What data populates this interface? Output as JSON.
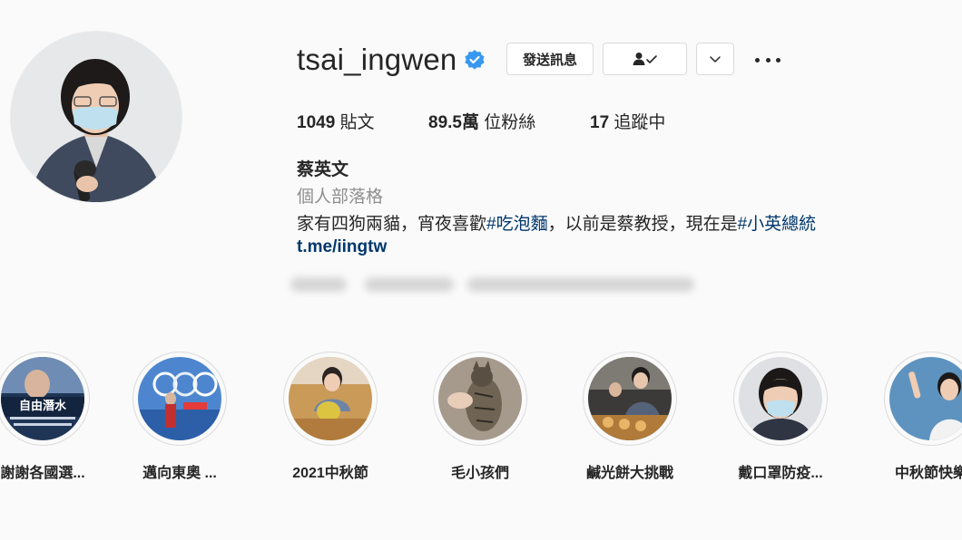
{
  "profile": {
    "username": "tsai_ingwen",
    "verified": true,
    "avatar_icon": "profile-photo",
    "buttons": {
      "message_label": "發送訊息",
      "following_icon": "user-check-icon",
      "dropdown_icon": "chevron-down-icon",
      "more_icon": "more-horizontal-icon"
    },
    "stats": {
      "posts_count": "1049",
      "posts_label": "貼文",
      "followers_count": "89.5萬",
      "followers_label": "位粉絲",
      "following_count": "17",
      "following_label": "追蹤中"
    },
    "name": "蔡英文",
    "category": "個人部落格",
    "bio": {
      "text_1": "家有四狗兩貓，宵夜喜歡",
      "hashtag_1": "#吃泡麵",
      "text_2": "，以前是蔡教授，現在是",
      "hashtag_2": "#小英總統"
    },
    "link": "t.me/iingtw"
  },
  "highlights": [
    {
      "label": "謝謝各國選..."
    },
    {
      "label": "邁向東奧 ..."
    },
    {
      "label": "2021中秋節"
    },
    {
      "label": "毛小孩們"
    },
    {
      "label": "鹹光餅大挑戰"
    },
    {
      "label": "戴口罩防疫..."
    },
    {
      "label": "中秋節快樂"
    }
  ],
  "colors": {
    "background": "#fafafa",
    "text": "#262626",
    "secondary": "#8e8e8e",
    "link": "#00376b",
    "verified": "#3897f0",
    "border": "#dbdbdb"
  }
}
